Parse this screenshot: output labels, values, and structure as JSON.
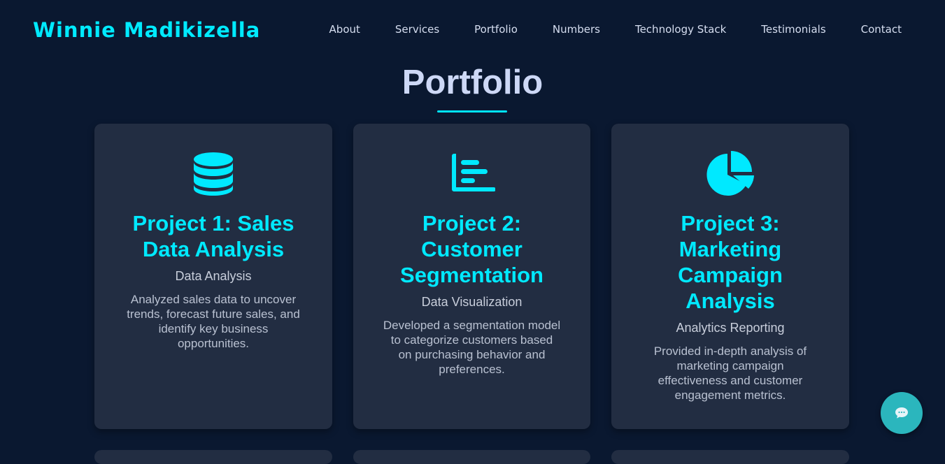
{
  "header": {
    "logo": "Winnie Madikizella",
    "nav": [
      "About",
      "Services",
      "Portfolio",
      "Numbers",
      "Technology Stack",
      "Testimonials",
      "Contact"
    ]
  },
  "portfolio": {
    "title": "Portfolio",
    "projects": [
      {
        "icon": "database-icon",
        "title": "Project 1: Sales Data Analysis",
        "category": "Data Analysis",
        "description": "Analyzed sales data to uncover trends, forecast future sales, and identify key business opportunities."
      },
      {
        "icon": "bar-chart-icon",
        "title": "Project 2: Customer Segmentation",
        "category": "Data Visualization",
        "description": "Developed a segmentation model to categorize customers based on purchasing behavior and preferences."
      },
      {
        "icon": "pie-chart-icon",
        "title": "Project 3: Marketing Campaign Analysis",
        "category": "Analytics Reporting",
        "description": "Provided in-depth analysis of marketing campaign effectiveness and customer engagement metrics."
      }
    ]
  },
  "chat": {
    "icon": "chat-bubble-icon"
  },
  "colors": {
    "accent": "#00e9ff",
    "background": "#0a1830",
    "card": "#222d42",
    "chat": "#2bb6bd"
  }
}
